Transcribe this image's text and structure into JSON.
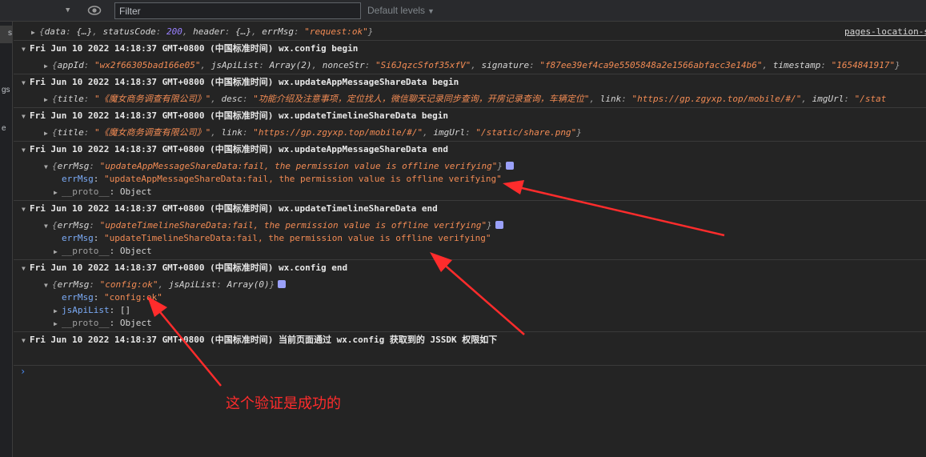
{
  "toolbar": {
    "filter_placeholder": "Filter",
    "levels_label": "Default levels",
    "levels_arrow": "▼",
    "caret": "▼"
  },
  "sidebar": {
    "fragments": [
      "s",
      "gs",
      "e"
    ]
  },
  "rows": {
    "r0": {
      "data_key": "data",
      "data_val": "{…}",
      "status_key": "statusCode",
      "status_val": "200",
      "header_key": "header",
      "header_val": "{…}",
      "err_key": "errMsg",
      "err_val": "\"request:ok\"",
      "source": "pages-location-s"
    },
    "r1": {
      "header": "Fri Jun 10 2022 14:18:37 GMT+0800 (中国标准时间) wx.config begin"
    },
    "r1d": {
      "appId_key": "appId",
      "appId_val": "\"wx2f66305bad166e05\"",
      "jsApi_key": "jsApiList",
      "jsApi_val": "Array(2)",
      "nonce_key": "nonceStr",
      "nonce_val": "\"Si6JqzcSfof35xfV\"",
      "sig_key": "signature",
      "sig_val": "\"f87ee39ef4ca9e5505848a2e1566abfacc3e14b6\"",
      "ts_key": "timestamp",
      "ts_val": "\"1654841917\""
    },
    "r2": {
      "header": "Fri Jun 10 2022 14:18:37 GMT+0800 (中国标准时间) wx.updateAppMessageShareData begin"
    },
    "r2d": {
      "title_key": "title",
      "title_val": "\"《魔女商务调查有限公司》\"",
      "desc_key": "desc",
      "desc_val": "\"功能介绍及注意事项，定位找人，微信聊天记录同步查询，开房记录查询，车辆定位\"",
      "link_key": "link",
      "link_val": "\"https://gp.zgyxp.top/mobile/#/\"",
      "img_key": "imgUrl",
      "img_val": "\"/stat"
    },
    "r3": {
      "header": "Fri Jun 10 2022 14:18:37 GMT+0800 (中国标准时间) wx.updateTimelineShareData begin"
    },
    "r3d": {
      "title_key": "title",
      "title_val": "\"《魔女商务调查有限公司》\"",
      "link_key": "link",
      "link_val": "\"https://gp.zgyxp.top/mobile/#/\"",
      "img_key": "imgUrl",
      "img_val": "\"/static/share.png\""
    },
    "r4": {
      "header": "Fri Jun 10 2022 14:18:37 GMT+0800 (中国标准时间) wx.updateAppMessageShareData end"
    },
    "r4d": {
      "summary_key": "errMsg",
      "summary_val": "\"updateAppMessageShareData:fail, the permission value is offline verifying\"",
      "err_key": "errMsg",
      "err_val": "\"updateAppMessageShareData:fail, the permission value is offline verifying\"",
      "proto_key": "__proto__",
      "proto_val": "Object"
    },
    "r5": {
      "header": "Fri Jun 10 2022 14:18:37 GMT+0800 (中国标准时间) wx.updateTimelineShareData end"
    },
    "r5d": {
      "summary_key": "errMsg",
      "summary_val": "\"updateTimelineShareData:fail, the permission value is offline verifying\"",
      "err_key": "errMsg",
      "err_val": "\"updateTimelineShareData:fail, the permission value is offline verifying\"",
      "proto_key": "__proto__",
      "proto_val": "Object"
    },
    "r6": {
      "header": "Fri Jun 10 2022 14:18:37 GMT+0800 (中国标准时间) wx.config end"
    },
    "r6d": {
      "summary_key": "errMsg",
      "summary_val": "\"config:ok\"",
      "summary_js_key": "jsApiList",
      "summary_js_val": "Array(0)",
      "err_key": "errMsg",
      "err_val": "\"config:ok\"",
      "js_key": "jsApiList",
      "js_val": "[]",
      "proto_key": "__proto__",
      "proto_val": "Object"
    },
    "r7": {
      "header": "Fri Jun 10 2022 14:18:37 GMT+0800 (中国标准时间) 当前页面通过 wx.config 获取到的 JSSDK 权限如下"
    }
  },
  "prompt_glyph": "›",
  "annotation": {
    "caption": "这个验证是成功的",
    "color": "#ff2c2c"
  },
  "colors": {
    "string": "#f28b54",
    "number": "#9980ff",
    "property": "#7cacf8",
    "background": "#242424"
  }
}
